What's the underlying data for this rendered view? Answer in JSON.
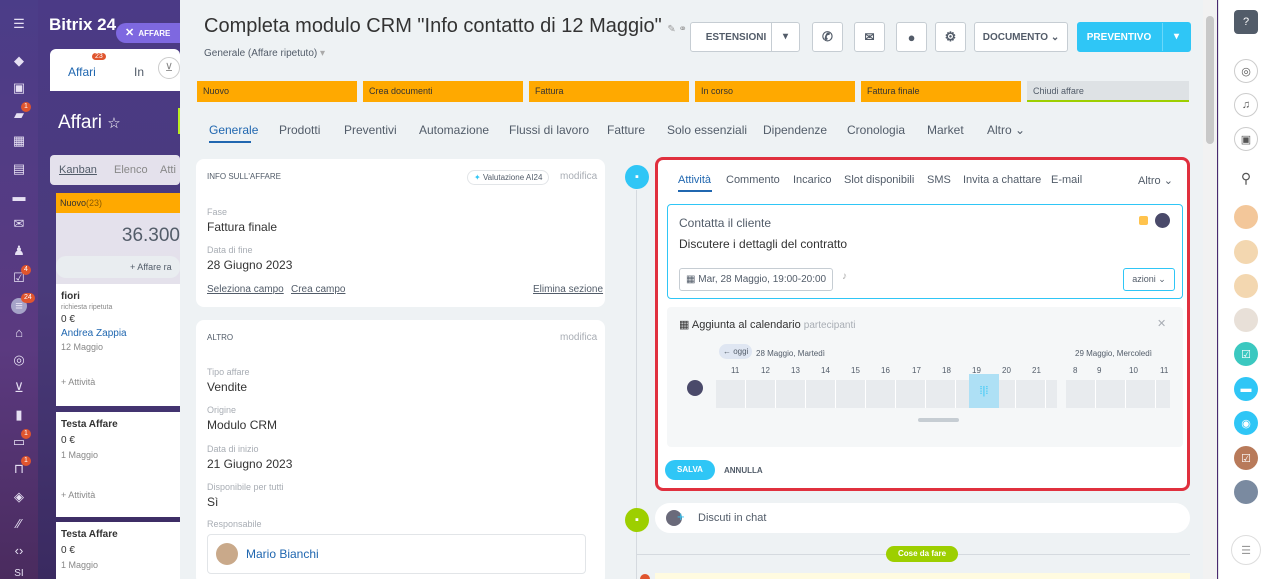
{
  "app": {
    "brand": "Bitrix 24",
    "close_label": "AFFARE"
  },
  "left_nav": {
    "badges": [
      "1",
      "4",
      "24",
      "1",
      "1"
    ]
  },
  "bg": {
    "tab_affari": "Affari",
    "tab_affari_badge": "23",
    "tab_in": "In",
    "title": "Affari",
    "view_kanban": "Kanban",
    "view_elenco": "Elenco",
    "view_att": "Atti",
    "column_name": "Nuovo",
    "column_count": "(23)",
    "column_amount": "36.300",
    "add_deal": "+ Affare ra",
    "cards": [
      {
        "title": "fiori",
        "sub": "richiesta ripetuta",
        "amount": "0 €",
        "contact": "Andrea Zappia",
        "date": "12 Maggio",
        "act": "+ Attività"
      },
      {
        "title": "Testa Affare",
        "amount": "0 €",
        "date": "1 Maggio",
        "act": "+ Attività"
      },
      {
        "title": "Testa Affare",
        "amount": "0 €",
        "date": "1 Maggio"
      }
    ]
  },
  "header": {
    "title": "Completa modulo CRM \"Info contatto di 12 Maggio\"",
    "subtitle": "Generale (Affare ripetuto)",
    "estensioni": "ESTENSIONI",
    "documento": "DOCUMENTO",
    "preventivo": "PREVENTIVO"
  },
  "stages": [
    "Nuovo",
    "Crea documenti",
    "Fattura",
    "In corso",
    "Fattura finale",
    "Chiudi affare"
  ],
  "tabs": [
    "Generale",
    "Prodotti",
    "Preventivi",
    "Automazione",
    "Flussi di lavoro",
    "Fatture",
    "Solo essenziali",
    "Dipendenze",
    "Cronologia",
    "Market",
    "Altro"
  ],
  "info": {
    "heading": "INFO SULL'AFFARE",
    "ai": "Valutazione AI24",
    "edit": "modifica",
    "fase_label": "Fase",
    "fase": "Fattura finale",
    "fine_label": "Data di fine",
    "fine": "28 Giugno 2023",
    "sel": "Seleziona campo",
    "crea": "Crea campo",
    "elim": "Elimina sezione"
  },
  "altro": {
    "heading": "ALTRO",
    "edit": "modifica",
    "tipo_label": "Tipo affare",
    "tipo": "Vendite",
    "orig_label": "Origine",
    "orig": "Modulo CRM",
    "inizio_label": "Data di inizio",
    "inizio": "21 Giugno 2023",
    "disp_label": "Disponibile per tutti",
    "disp": "Sì",
    "resp_label": "Responsabile",
    "resp": "Mario Bianchi"
  },
  "activity": {
    "tabs": [
      "Attività",
      "Commento",
      "Incarico",
      "Slot disponibili",
      "SMS",
      "Invita a chattare",
      "E-mail"
    ],
    "more": "Altro",
    "title": "Contatta il cliente",
    "desc": "Discutere i dettagli del contratto",
    "date": "Mar, 28 Maggio, 19:00-20:00",
    "azioni": "azioni",
    "cal_title": "Aggiunta al calendario",
    "cal_part": "partecipanti",
    "oggi": "← oggi",
    "day1": "28 Maggio, Martedì",
    "day2": "29 Maggio, Mercoledì",
    "hours1": [
      "11",
      "12",
      "13",
      "14",
      "15",
      "16",
      "17",
      "18",
      "19",
      "20",
      "21"
    ],
    "hours2": [
      "8",
      "9",
      "10",
      "11"
    ],
    "save": "SALVA",
    "cancel": "ANNULLA"
  },
  "chat": {
    "placeholder": "Discuti in chat"
  },
  "todo": {
    "label": "Cose da fare"
  },
  "colors": {
    "stage": "#ffa900",
    "primary": "#2fc6f6",
    "accent": "#2066b0",
    "highlight": "#e0303e"
  }
}
